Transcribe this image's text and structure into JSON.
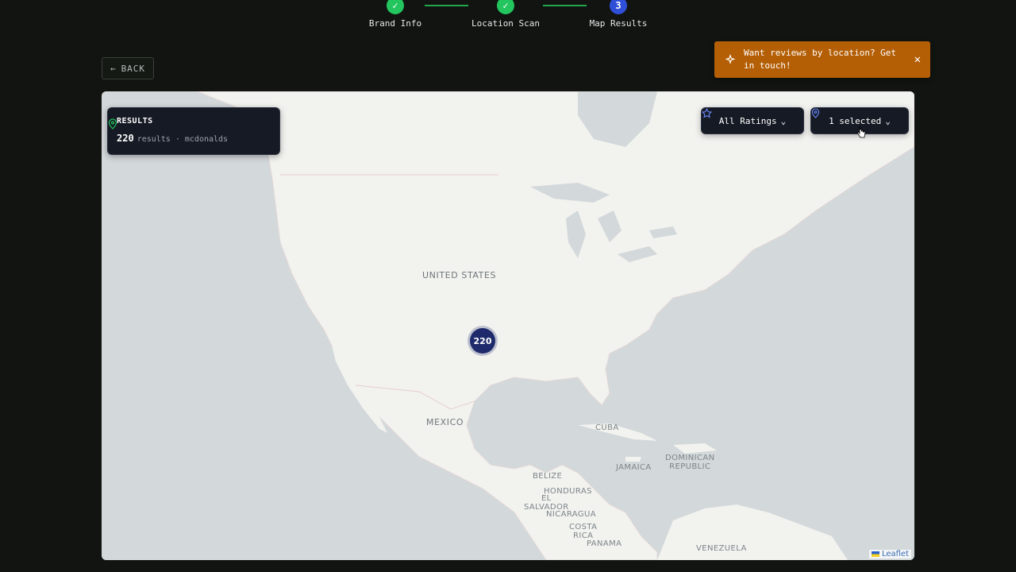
{
  "stepper": {
    "steps": [
      {
        "label": "Brand Info",
        "state": "done",
        "marker": "✓"
      },
      {
        "label": "Location Scan",
        "state": "done",
        "marker": "✓"
      },
      {
        "label": "Map Results",
        "state": "current",
        "marker": "3"
      }
    ]
  },
  "back_button": {
    "label": "BACK",
    "icon": "arrow-left-icon"
  },
  "toast": {
    "message_line1": "Want reviews by location? Get",
    "message_line2": "in touch!",
    "icon": "sparkle-icon",
    "close_icon": "close-icon",
    "color": "#b45f06"
  },
  "results_card": {
    "title": "RESULTS",
    "count": "220",
    "suffix": "results · mcdonalds",
    "icon": "map-pin-icon"
  },
  "filters": {
    "ratings": {
      "label": "All Ratings",
      "icon": "star-icon"
    },
    "locations": {
      "label": "1 selected",
      "icon": "map-pin-icon"
    }
  },
  "map": {
    "labels": {
      "us": "UNITED STATES",
      "mexico": "MEXICO",
      "cuba": "CUBA",
      "jamaica": "JAMAICA",
      "dominican": "DOMINICAN",
      "republic": "REPUBLIC",
      "belize": "BELIZE",
      "honduras": "HONDURAS",
      "el": "EL",
      "salvador": "SALVADOR",
      "nicaragua": "NICARAGUA",
      "costa": "COSTA",
      "rica": "RICA",
      "panama": "PANAMA",
      "venezuela": "VENEZUELA"
    },
    "cluster_count": "220",
    "attribution": "Leaflet"
  },
  "colors": {
    "done": "#22c55e",
    "current": "#2f4fd8",
    "cluster": "#1e2a6b",
    "land": "#f2f2ef",
    "water": "#d3d8da"
  }
}
